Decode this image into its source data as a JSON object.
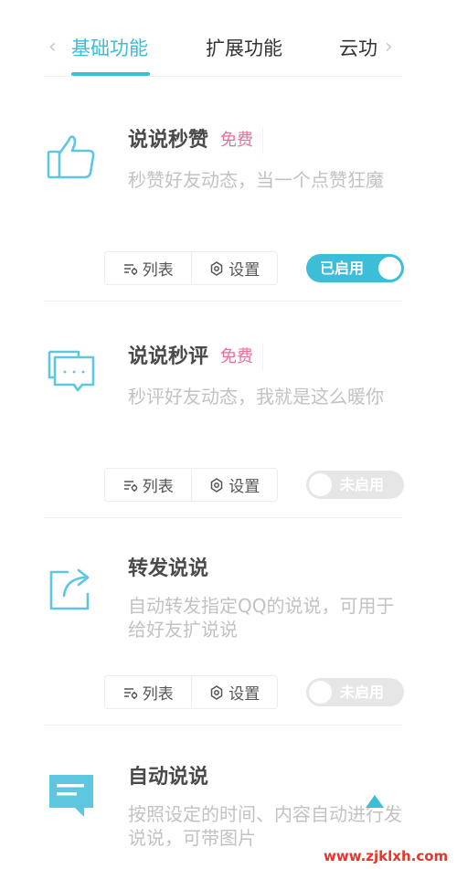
{
  "tabs": {
    "items": [
      {
        "label": "基础功能"
      },
      {
        "label": "扩展功能"
      },
      {
        "label": "云功"
      }
    ],
    "accent": "#3cbdd8"
  },
  "features": [
    {
      "title": "说说秒赞",
      "badge": "免费",
      "desc": "秒赞好友动态，当一个点赞狂魔",
      "list_label": "列表",
      "settings_label": "设置",
      "toggle_label": "已启用",
      "enabled": true,
      "icon": "thumbs-up-icon"
    },
    {
      "title": "说说秒评",
      "badge": "免费",
      "desc": "秒评好友动态，我就是这么暖你",
      "list_label": "列表",
      "settings_label": "设置",
      "toggle_label": "未启用",
      "enabled": false,
      "icon": "chat-bubbles-icon"
    },
    {
      "title": "转发说说",
      "badge": "",
      "desc": "自动转发指定QQ的说说，可用于给好友扩说说",
      "list_label": "列表",
      "settings_label": "设置",
      "toggle_label": "未启用",
      "enabled": false,
      "icon": "share-icon"
    },
    {
      "title": "自动说说",
      "badge": "",
      "desc": "按照设定的时间、内容自动进行发说说，可带图片",
      "icon": "message-icon"
    }
  ],
  "watermark": "www.zjklxh.com",
  "colors": {
    "accent": "#3cbdd8",
    "badge": "#f06a9c",
    "off": "#e6e6e6",
    "watermark": "#e6352b"
  }
}
